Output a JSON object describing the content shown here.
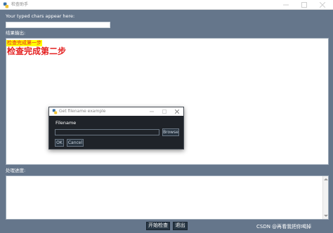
{
  "window": {
    "title": "检查助手",
    "icon": "python-icon"
  },
  "main": {
    "typed_label": "Your typed chars appear here:",
    "typed_value": "",
    "result_label": "结果输出:",
    "output_lines": [
      "检查完成第一步",
      "检查完成第二步"
    ],
    "progress_label": "处理进度:",
    "progress_value": "",
    "start_button": "开始检查",
    "exit_button": "退出"
  },
  "dialog": {
    "title": "Get filename example",
    "icon": "python-icon",
    "filename_label": "Filename",
    "filename_value": "",
    "browse_button": "Browse",
    "ok_button": "OK",
    "cancel_button": "Cancel"
  },
  "watermark": "CSDN @再看我把你喝掉",
  "colors": {
    "window_bg": "#65768b",
    "dialog_bg": "#1f2329",
    "highlight_bg": "#ffff00",
    "output_text": "#e41e1e",
    "button_bg": "#293846"
  }
}
